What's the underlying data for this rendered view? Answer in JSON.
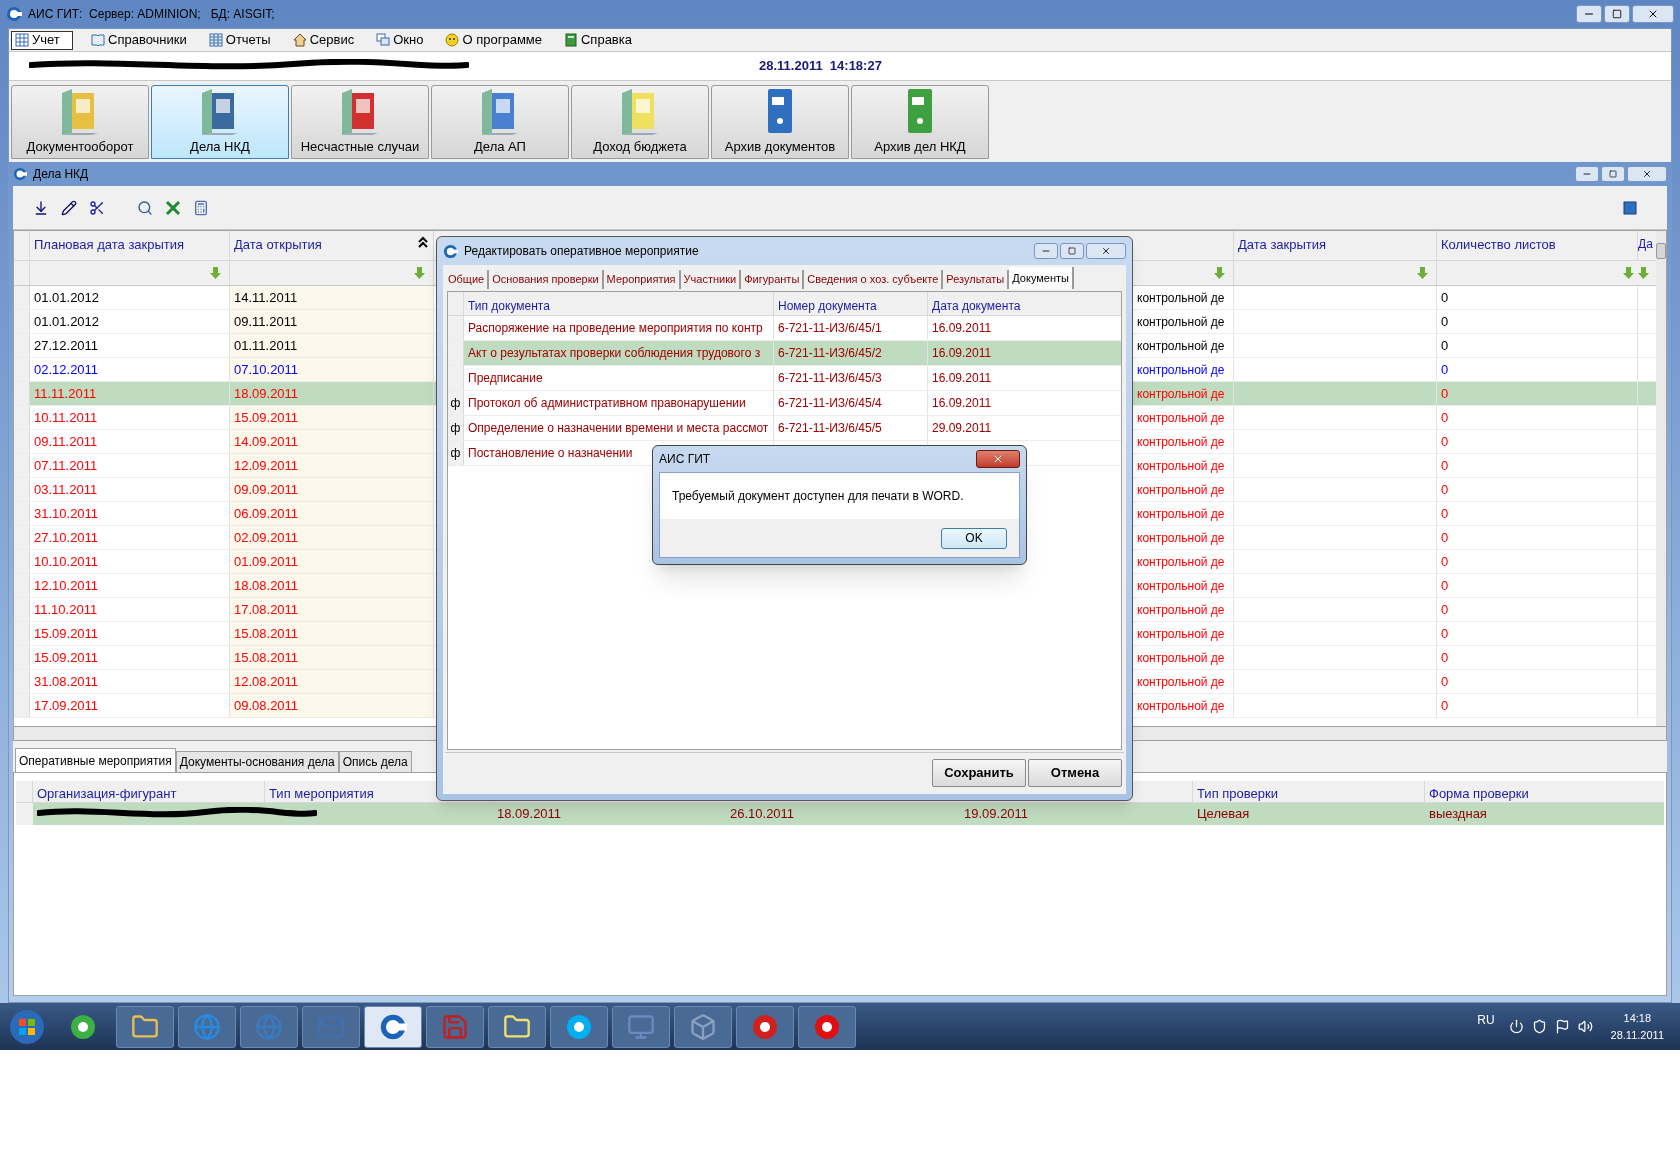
{
  "window": {
    "title": "АИС ГИТ:  Сервер: ADMINION;   БД: AISGIT;"
  },
  "menu": [
    {
      "label": "Учет",
      "selected": true
    },
    {
      "label": "Справочники",
      "selected": false
    },
    {
      "label": "Отчеты",
      "selected": false
    },
    {
      "label": "Сервис",
      "selected": false
    },
    {
      "label": "Окно",
      "selected": false
    },
    {
      "label": "О программе",
      "selected": false
    },
    {
      "label": "Справка",
      "selected": false
    }
  ],
  "info_bar": {
    "datetime": "28.11.2011  14:18:27"
  },
  "modules": [
    {
      "label": "Документооборот",
      "selected": false
    },
    {
      "label": "Дела НКД",
      "selected": true
    },
    {
      "label": "Несчастные случаи",
      "selected": false
    },
    {
      "label": "Дела АП",
      "selected": false
    },
    {
      "label": "Доход бюджета",
      "selected": false
    },
    {
      "label": "Архив документов",
      "selected": false
    },
    {
      "label": "Архив дел НКД",
      "selected": false
    }
  ],
  "cases_window": {
    "title": "Дела НКД",
    "columns": [
      "Плановая дата закрытия",
      "Дата открытия",
      "Дата закрытия",
      "Количество листов",
      "Да"
    ],
    "rows": [
      {
        "plan_close": "01.01.2012",
        "opened": "14.11.2011",
        "column_3": "контрольной де",
        "sheets": "0",
        "color": "#000000",
        "selected": false
      },
      {
        "plan_close": "01.01.2012",
        "opened": "09.11.2011",
        "column_3": "контрольной де",
        "sheets": "0",
        "color": "#000000",
        "selected": false
      },
      {
        "plan_close": "27.12.2011",
        "opened": "01.11.2011",
        "column_3": "контрольной де",
        "sheets": "0",
        "color": "#000000",
        "selected": false
      },
      {
        "plan_close": "02.12.2011",
        "opened": "07.10.2011",
        "column_3": "контрольной де",
        "sheets": "0",
        "color": "#0000ff",
        "selected": false
      },
      {
        "plan_close": "11.11.2011",
        "opened": "18.09.2011",
        "column_3": "контрольной де",
        "sheets": "0",
        "color": "#ff0000",
        "selected": true
      },
      {
        "plan_close": "10.11.2011",
        "opened": "15.09.2011",
        "column_3": "контрольной де",
        "sheets": "0",
        "color": "#ff0000",
        "selected": false
      },
      {
        "plan_close": "09.11.2011",
        "opened": "14.09.2011",
        "column_3": "контрольной де",
        "sheets": "0",
        "color": "#ff0000",
        "selected": false
      },
      {
        "plan_close": "07.11.2011",
        "opened": "12.09.2011",
        "column_3": "контрольной де",
        "sheets": "0",
        "color": "#ff0000",
        "selected": false
      },
      {
        "plan_close": "03.11.2011",
        "opened": "09.09.2011",
        "column_3": "контрольной де",
        "sheets": "0",
        "color": "#ff0000",
        "selected": false
      },
      {
        "plan_close": "31.10.2011",
        "opened": "06.09.2011",
        "column_3": "контрольной де",
        "sheets": "0",
        "color": "#ff0000",
        "selected": false
      },
      {
        "plan_close": "27.10.2011",
        "opened": "02.09.2011",
        "column_3": "контрольной де",
        "sheets": "0",
        "color": "#ff0000",
        "selected": false
      },
      {
        "plan_close": "10.10.2011",
        "opened": "01.09.2011",
        "column_3": "контрольной де",
        "sheets": "0",
        "color": "#ff0000",
        "selected": false
      },
      {
        "plan_close": "12.10.2011",
        "opened": "18.08.2011",
        "column_3": "контрольной де",
        "sheets": "0",
        "color": "#ff0000",
        "selected": false
      },
      {
        "plan_close": "11.10.2011",
        "opened": "17.08.2011",
        "column_3": "контрольной де",
        "sheets": "0",
        "color": "#ff0000",
        "selected": false
      },
      {
        "plan_close": "15.09.2011",
        "opened": "15.08.2011",
        "column_3": "контрольной де",
        "sheets": "0",
        "color": "#ff0000",
        "selected": false
      },
      {
        "plan_close": "15.09.2011",
        "opened": "15.08.2011",
        "column_3": "контрольной де",
        "sheets": "0",
        "color": "#ff0000",
        "selected": false
      },
      {
        "plan_close": "31.08.2011",
        "opened": "12.08.2011",
        "column_3": "контрольной де",
        "sheets": "0",
        "color": "#ff0000",
        "selected": false
      },
      {
        "plan_close": "17.09.2011",
        "opened": "09.08.2011",
        "column_3": "контрольной де",
        "sheets": "0",
        "color": "#ff0000",
        "selected": false
      }
    ],
    "bottom_tabs": [
      {
        "label": "Оперативные мероприятия",
        "selected": true
      },
      {
        "label": "Документы-основания дела",
        "selected": false
      },
      {
        "label": "Опись дела",
        "selected": false
      }
    ],
    "bottom_table": {
      "columns": [
        "Организация-фигурант",
        "Тип мероприятия",
        "Тип проверки",
        "Форма проверки"
      ],
      "rows": [
        {
          "column_3": "18.09.2011",
          "column_4": "26.10.2011",
          "column_5": "19.09.2011",
          "check_type": "Целевая",
          "check_form": "выездная",
          "selected": true
        }
      ]
    }
  },
  "edit_dialog": {
    "title": "Редактировать оперативное мероприятие",
    "tabs": [
      {
        "label": "Общие",
        "selected": false
      },
      {
        "label": "Основания проверки",
        "selected": false
      },
      {
        "label": "Мероприятия",
        "selected": false
      },
      {
        "label": "Участники",
        "selected": false
      },
      {
        "label": "Фигуранты",
        "selected": false
      },
      {
        "label": "Сведения о хоз. субъекте",
        "selected": false
      },
      {
        "label": "Результаты",
        "selected": false
      },
      {
        "label": "Документы",
        "selected": true
      }
    ],
    "columns": [
      "Тип документа",
      "Номер документа",
      "Дата документа"
    ],
    "rows": [
      {
        "type": "Распоряжение на проведение мероприятия по контр",
        "number": "6-721-11-ИЗ/6/45/1",
        "date": "16.09.2011",
        "selected": false
      },
      {
        "type": "Акт о результатах проверки соблюдения трудового з",
        "number": "6-721-11-ИЗ/6/45/2",
        "date": "16.09.2011",
        "selected": true
      },
      {
        "type": "Предписание",
        "number": "6-721-11-ИЗ/6/45/3",
        "date": "16.09.2011",
        "selected": false
      },
      {
        "marker": "ф",
        "type": "Протокол об административном правонарушении",
        "number": "6-721-11-ИЗ/6/45/4",
        "date": "16.09.2011",
        "selected": false
      },
      {
        "marker": "ф",
        "type": "Определение о назначении времени и места рассмот",
        "number": "6-721-11-ИЗ/6/45/5",
        "date": "29.09.2011",
        "selected": false
      },
      {
        "marker": "ф",
        "type": "Постановление о назначении",
        "selected": false
      }
    ],
    "buttons": [
      "Сохранить",
      "Отмена"
    ]
  },
  "message_box": {
    "title": "АИС ГИТ",
    "text": "Требуемый документ доступен для печати в WORD.",
    "button": "OK"
  },
  "taskbar": {
    "language": "RU",
    "time": "14:18",
    "date": "28.11.2011"
  }
}
